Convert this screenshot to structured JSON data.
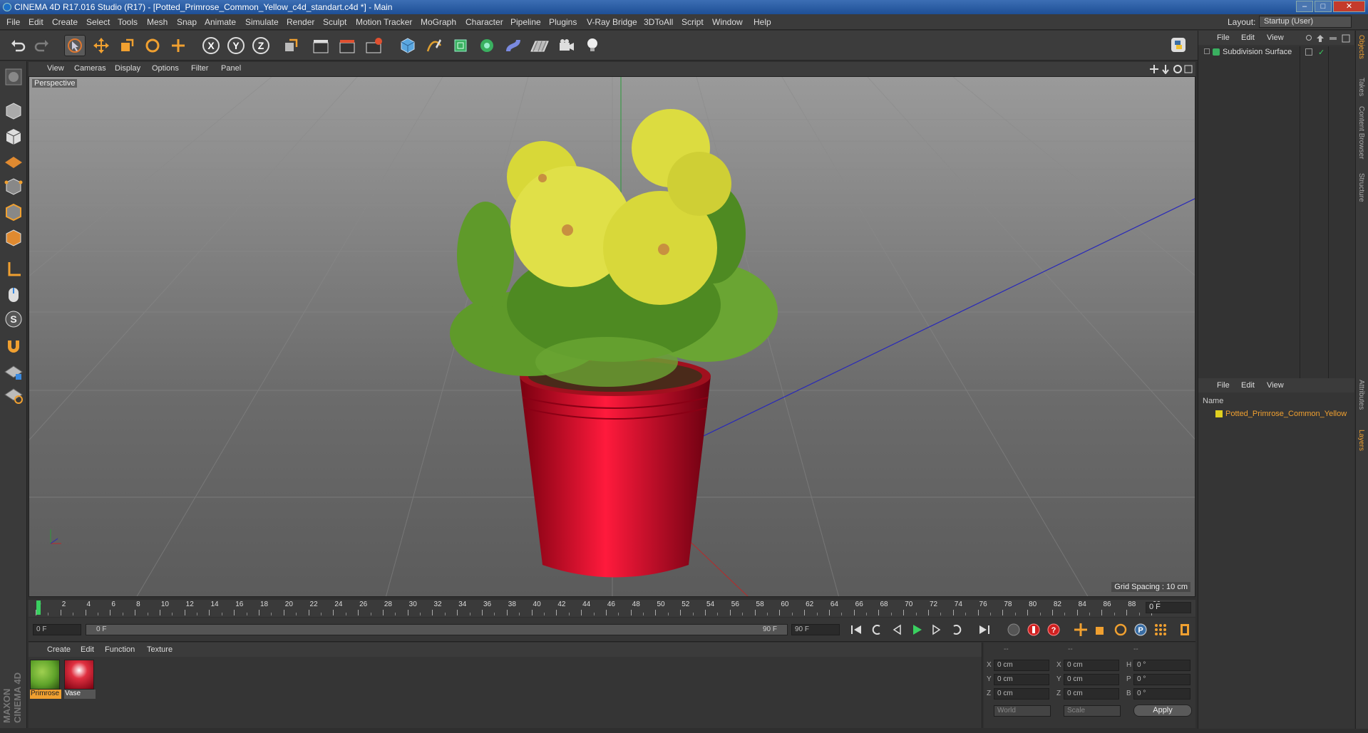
{
  "window": {
    "title": "CINEMA 4D R17.016 Studio (R17) - [Potted_Primrose_Common_Yellow_c4d_standart.c4d *] - Main",
    "controls": [
      "–",
      "□",
      "✕"
    ]
  },
  "menu": {
    "items": [
      "File",
      "Edit",
      "Create",
      "Select",
      "Tools",
      "Mesh",
      "Snap",
      "Animate",
      "Simulate",
      "Render",
      "Sculpt",
      "Motion Tracker",
      "MoGraph",
      "Character",
      "Pipeline",
      "Plugins",
      "V-Ray Bridge",
      "3DToAll",
      "Script",
      "Window",
      "Help"
    ],
    "layout_label": "Layout:",
    "layout_value": "Startup (User)"
  },
  "toolbar": {
    "axis": [
      "X",
      "Y",
      "Z"
    ]
  },
  "viewport": {
    "menu": [
      "View",
      "Cameras",
      "Display",
      "Options",
      "Filter",
      "Panel"
    ],
    "label": "Perspective",
    "grid_spacing": "Grid Spacing : 10 cm"
  },
  "timeline": {
    "ticks": [
      "0",
      "2",
      "4",
      "6",
      "8",
      "10",
      "12",
      "14",
      "16",
      "18",
      "20",
      "22",
      "24",
      "26",
      "28",
      "30",
      "32",
      "34",
      "36",
      "38",
      "40",
      "42",
      "44",
      "46",
      "48",
      "50",
      "52",
      "54",
      "56",
      "58",
      "60",
      "62",
      "64",
      "66",
      "68",
      "70",
      "72",
      "74",
      "76",
      "78",
      "80",
      "82",
      "84",
      "86",
      "88",
      "90"
    ],
    "current_frame": "0 F"
  },
  "transport": {
    "start_field": "0 F",
    "range_start": "0 F",
    "range_end": "90 F",
    "end_field": "90 F"
  },
  "material_manager": {
    "menu": [
      "Create",
      "Edit",
      "Function",
      "Texture"
    ],
    "materials": [
      {
        "name": "Primrose",
        "color": "#5fa32a"
      },
      {
        "name": "Vase",
        "color": "#c0101e"
      }
    ]
  },
  "coordinates": {
    "header": [
      "--",
      "--",
      "--"
    ],
    "rows": [
      {
        "a": "X",
        "av": "0 cm",
        "b": "X",
        "bv": "0 cm",
        "c": "H",
        "cv": "0 °"
      },
      {
        "a": "Y",
        "av": "0 cm",
        "b": "Y",
        "bv": "0 cm",
        "c": "P",
        "cv": "0 °"
      },
      {
        "a": "Z",
        "av": "0 cm",
        "b": "Z",
        "bv": "0 cm",
        "c": "B",
        "cv": "0 °"
      }
    ],
    "mode1": "World",
    "mode2": "Scale",
    "apply": "Apply"
  },
  "object_manager": {
    "menu": [
      "File",
      "Edit",
      "View"
    ],
    "object": "Subdivision Surface"
  },
  "layer_manager": {
    "menu": [
      "File",
      "Edit",
      "View"
    ],
    "column": "Name",
    "layer": "Potted_Primrose_Common_Yellow"
  },
  "side_tabs": [
    "Objects",
    "Takes",
    "Content Browser",
    "Structure",
    "Attributes",
    "Layers"
  ],
  "brand": "MAXON CINEMA 4D",
  "colors": {
    "accent": "#f0a030",
    "pot": "#d0102a",
    "flower": "#d8d830"
  }
}
